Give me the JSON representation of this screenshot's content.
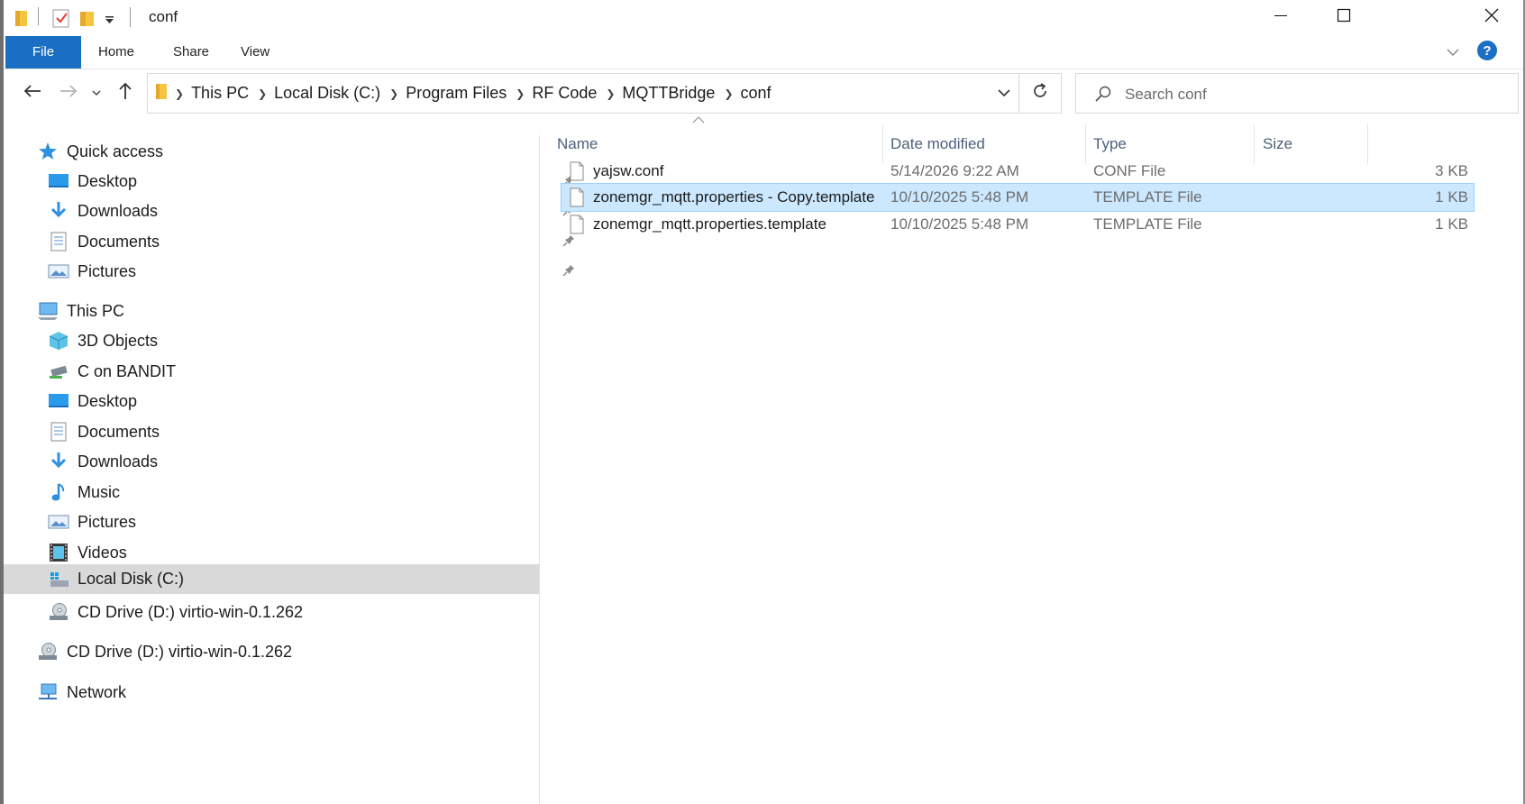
{
  "window": {
    "title": "conf",
    "controls": [
      "minimize-icon",
      "maximize-icon",
      "close-icon"
    ]
  },
  "ribbon": {
    "tabs": [
      "File",
      "Home",
      "Share",
      "View"
    ],
    "accent": "#1a6fc4"
  },
  "address": {
    "breadcrumbs": [
      "This PC",
      "Local Disk (C:)",
      "Program Files",
      "RF Code",
      "MQTTBridge",
      "conf"
    ]
  },
  "search": {
    "placeholder": "Search conf"
  },
  "nav": {
    "quick_access": {
      "label": "Quick access",
      "items": [
        "Desktop",
        "Downloads",
        "Documents",
        "Pictures"
      ]
    },
    "this_pc": {
      "label": "This PC",
      "items": [
        "3D Objects",
        "C on BANDIT",
        "Desktop",
        "Documents",
        "Downloads",
        "Music",
        "Pictures",
        "Videos",
        "Local Disk (C:)",
        "CD Drive (D:) virtio-win-0.1.262"
      ]
    },
    "cd_drive": "CD Drive (D:) virtio-win-0.1.262",
    "network": "Network"
  },
  "columns": {
    "name": "Name",
    "date": "Date modified",
    "type": "Type",
    "size": "Size"
  },
  "files": [
    {
      "name": "yajsw.conf",
      "date": "5/14/2026 9:22 AM",
      "type": "CONF File",
      "size": "3 KB",
      "selected": false
    },
    {
      "name": "zonemgr_mqtt.properties - Copy.template",
      "date": "10/10/2025 5:48 PM",
      "type": "TEMPLATE File",
      "size": "1 KB",
      "selected": true
    },
    {
      "name": "zonemgr_mqtt.properties.template",
      "date": "10/10/2025 5:48 PM",
      "type": "TEMPLATE File",
      "size": "1 KB",
      "selected": false
    }
  ]
}
